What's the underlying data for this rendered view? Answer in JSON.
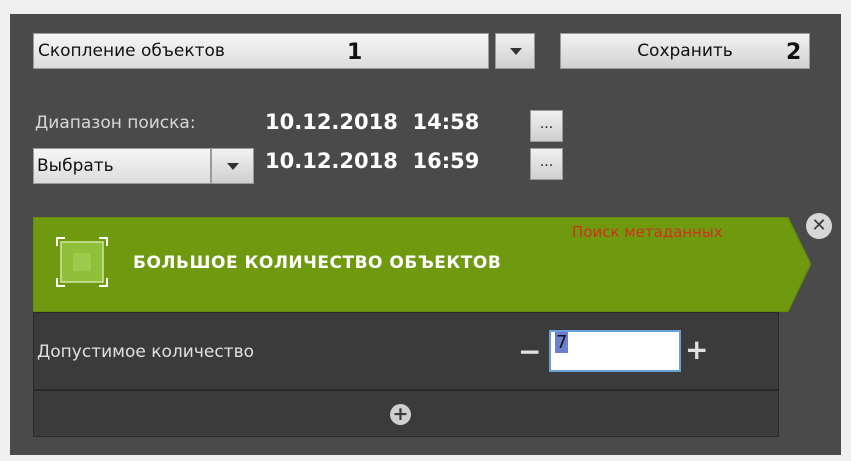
{
  "search": {
    "type_value": "Скопление объектов",
    "save_label": "Сохранить",
    "annotation_1": "1",
    "annotation_2": "2",
    "range_label": "Диапазон поиска:",
    "from_datetime": "10.12.2018  14:58",
    "to_datetime": "10.12.2018  16:59",
    "dots_label": "...",
    "select_value": "Выбрать"
  },
  "panel": {
    "title": "БОЛЬШОЕ КОЛИЧЕСТВО ОБЪЕКТОВ",
    "subtitle": "Поиск метаданных",
    "close_glyph": "✕",
    "accent_color": "#6f9a10"
  },
  "param": {
    "label": "Допустимое количество",
    "value": "7",
    "minus_glyph": "−",
    "plus_glyph": "+"
  },
  "add": {
    "glyph": "+"
  },
  "icons": [
    "dropdown-arrow-icon",
    "object-area-icon",
    "close-icon",
    "add-circle-icon"
  ]
}
